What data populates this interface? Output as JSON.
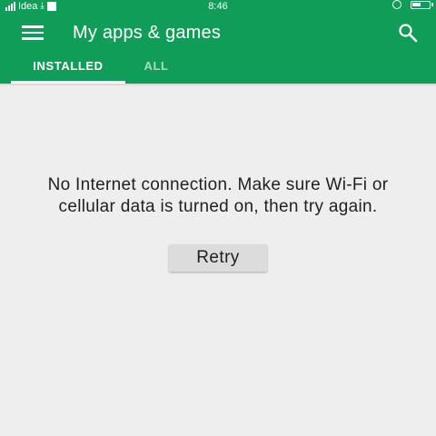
{
  "status_bar": {
    "carrier": "Idea",
    "time": "8:46"
  },
  "app_bar": {
    "title": "My apps & games",
    "icons": {
      "menu": "hamburger-menu-icon",
      "search": "search-icon"
    }
  },
  "tabs": [
    {
      "label": "INSTALLED",
      "selected": true
    },
    {
      "label": "ALL",
      "selected": false
    }
  ],
  "content": {
    "message": "No Internet connection. Make sure Wi-Fi or cellular data is turned on, then try again.",
    "retry_label": "Retry"
  },
  "colors": {
    "brand": "#0f9d58",
    "background": "#eeeeee",
    "button": "#dcdcdc"
  }
}
